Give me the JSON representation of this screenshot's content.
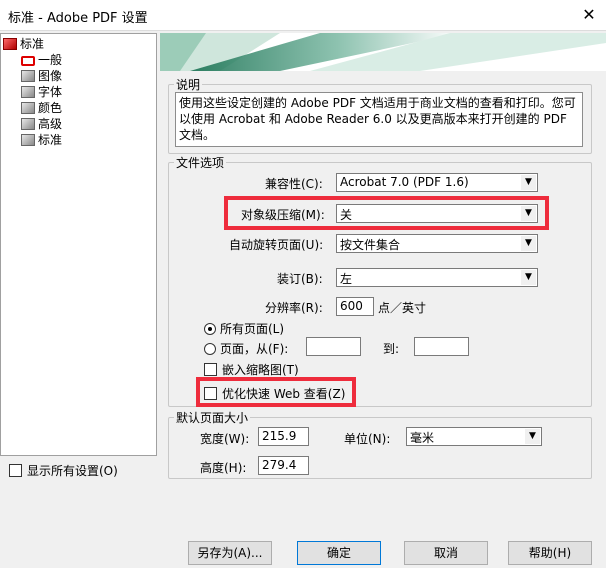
{
  "window": {
    "title": "标准 - Adobe PDF 设置",
    "close_glyph": "✕"
  },
  "tree": {
    "root": "标准",
    "items": [
      "一般",
      "图像",
      "字体",
      "颜色",
      "高级",
      "标准"
    ]
  },
  "show_all_settings": "显示所有设置(O)",
  "description": {
    "title": "说明",
    "text": "使用这些设定创建的 Adobe PDF 文档适用于商业文档的查看和打印。您可以使用 Acrobat 和 Adobe Reader 6.0 以及更高版本来打开创建的 PDF 文档。"
  },
  "file_options": {
    "title": "文件选项",
    "compat_label": "兼容性(C):",
    "compat_value": "Acrobat 7.0 (PDF 1.6)",
    "objcomp_label": "对象级压缩(M):",
    "objcomp_value": "关",
    "autorotate_label": "自动旋转页面(U):",
    "autorotate_value": "按文件集合",
    "binding_label": "装订(B):",
    "binding_value": "左",
    "resolution_label": "分辨率(R):",
    "resolution_value": "600",
    "resolution_unit": "点／英寸",
    "all_pages": "所有页面(L)",
    "pages_from": "页面，从(F):",
    "pages_to": "到:",
    "embed_thumbs": "嵌入缩略图(T)",
    "fast_web": "优化快速 Web 查看(Z)"
  },
  "page_size": {
    "title": "默认页面大小",
    "width_label": "宽度(W):",
    "width_value": "215.9",
    "height_label": "高度(H):",
    "height_value": "279.4",
    "unit_label": "单位(N):",
    "unit_value": "毫米"
  },
  "buttons": {
    "save_as": "另存为(A)...",
    "ok": "确定",
    "cancel": "取消",
    "help": "帮助(H)"
  },
  "colors": {
    "highlight": "#ee2c3c",
    "banner_green": "#1e7a5a"
  }
}
